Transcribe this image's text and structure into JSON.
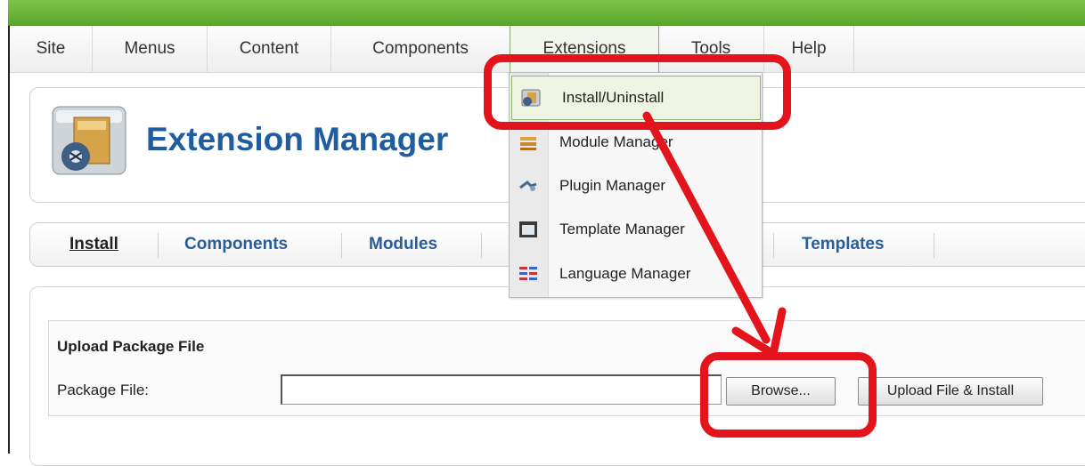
{
  "menubar": {
    "items": [
      {
        "label": "Site"
      },
      {
        "label": "Menus"
      },
      {
        "label": "Content"
      },
      {
        "label": "Components"
      },
      {
        "label": "Extensions"
      },
      {
        "label": "Tools"
      },
      {
        "label": "Help"
      }
    ]
  },
  "dropdown": {
    "items": [
      {
        "label": "Install/Uninstall",
        "icon": "install-icon"
      },
      {
        "label": "Module Manager",
        "icon": "module-icon"
      },
      {
        "label": "Plugin Manager",
        "icon": "plugin-icon"
      },
      {
        "label": "Template Manager",
        "icon": "template-icon"
      },
      {
        "label": "Language Manager",
        "icon": "language-icon"
      }
    ]
  },
  "page": {
    "title": "Extension Manager",
    "icon": "extension-manager-icon"
  },
  "subnav": {
    "tabs": [
      {
        "label": "Install"
      },
      {
        "label": "Components"
      },
      {
        "label": "Modules"
      },
      {
        "label": "Templates"
      }
    ]
  },
  "upload": {
    "legend": "Upload Package File",
    "field_label": "Package File:",
    "file_value": "",
    "browse_label": "Browse...",
    "install_label": "Upload File & Install"
  },
  "colors": {
    "accent_green": "#5aa52c",
    "title_blue": "#1f5da0",
    "annotation_red": "#e3141b"
  }
}
